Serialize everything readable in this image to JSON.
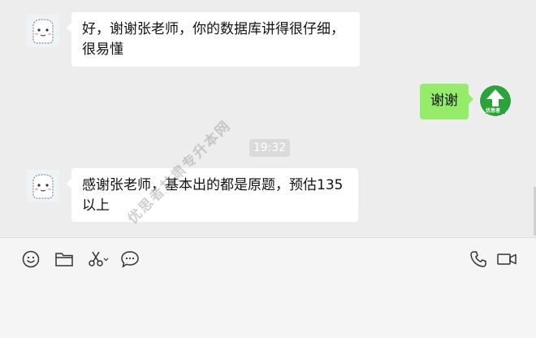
{
  "messages": [
    {
      "from": "teacher",
      "text": "好，谢谢张老师，你的数据库讲得很仔细，很易懂"
    },
    {
      "from": "me",
      "text": "谢谢"
    },
    {
      "from": "teacher",
      "text": "感谢张老师，基本出的都是原题，预估135以上"
    }
  ],
  "timestamp": "19:32",
  "my_avatar_text": "优思者",
  "watermark": "优思者甘肃专升本网",
  "toolbar": {
    "emoji": "emoji-icon",
    "folder": "folder-icon",
    "scissors": "scissors-icon",
    "chat": "chat-bubble-icon",
    "phone": "phone-icon",
    "video": "video-icon"
  },
  "colors": {
    "bubble_me": "#95ec69",
    "bubble_other": "#ffffff",
    "background": "#ededed"
  }
}
